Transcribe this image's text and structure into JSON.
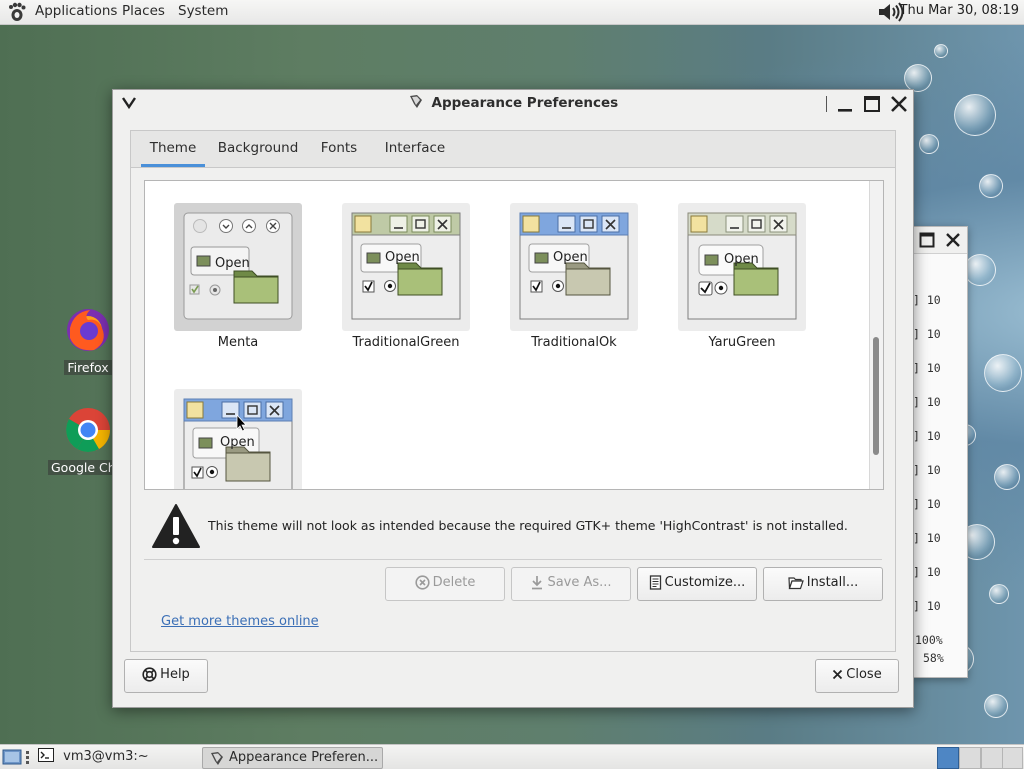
{
  "top_panel": {
    "menus": [
      "Applications",
      "Places",
      "System"
    ],
    "clock": "Thu Mar 30, 08:19",
    "icons": {
      "logo": "gnome-foot-icon",
      "volume": "volume-icon"
    }
  },
  "desktop": {
    "icons": [
      {
        "label": "Firefox",
        "icon": "firefox-icon"
      },
      {
        "label": "Google Chro",
        "icon": "chrome-icon"
      }
    ]
  },
  "background_window": {
    "lines": [
      "] 10",
      "] 10",
      "] 10",
      "] 10",
      "] 10",
      "] 10",
      "] 10",
      "] 10",
      "] 10",
      "] 10"
    ],
    "footer": [
      "100%",
      "58%"
    ]
  },
  "dialog": {
    "title": "Appearance Preferences",
    "tabs": [
      "Theme",
      "Background",
      "Fonts",
      "Interface"
    ],
    "active_tab": "Theme",
    "themes": [
      {
        "name": "Menta",
        "selected": true,
        "open_label": "Open"
      },
      {
        "name": "TraditionalGreen",
        "selected": false,
        "open_label": "Open"
      },
      {
        "name": "TraditionalOk",
        "selected": false,
        "open_label": "Open"
      },
      {
        "name": "YaruGreen",
        "selected": false,
        "open_label": "Open"
      },
      {
        "name": "",
        "selected": false,
        "open_label": "Open"
      }
    ],
    "warning": "This theme will not look as intended because the required GTK+ theme 'HighContrast' is not installed.",
    "buttons": {
      "delete": "Delete",
      "save_as": "Save As...",
      "customize": "Customize...",
      "install": "Install..."
    },
    "link": "Get more themes online",
    "help": "Help",
    "close": "Close"
  },
  "taskbar": {
    "items": [
      "vm3@vm3:~",
      "Appearance Preferen..."
    ],
    "workspaces": 4,
    "current_workspace": 1
  },
  "colors": {
    "accent": "#4a90d9",
    "link": "#3b6fb6",
    "workspace_active": "#4e86c4"
  }
}
